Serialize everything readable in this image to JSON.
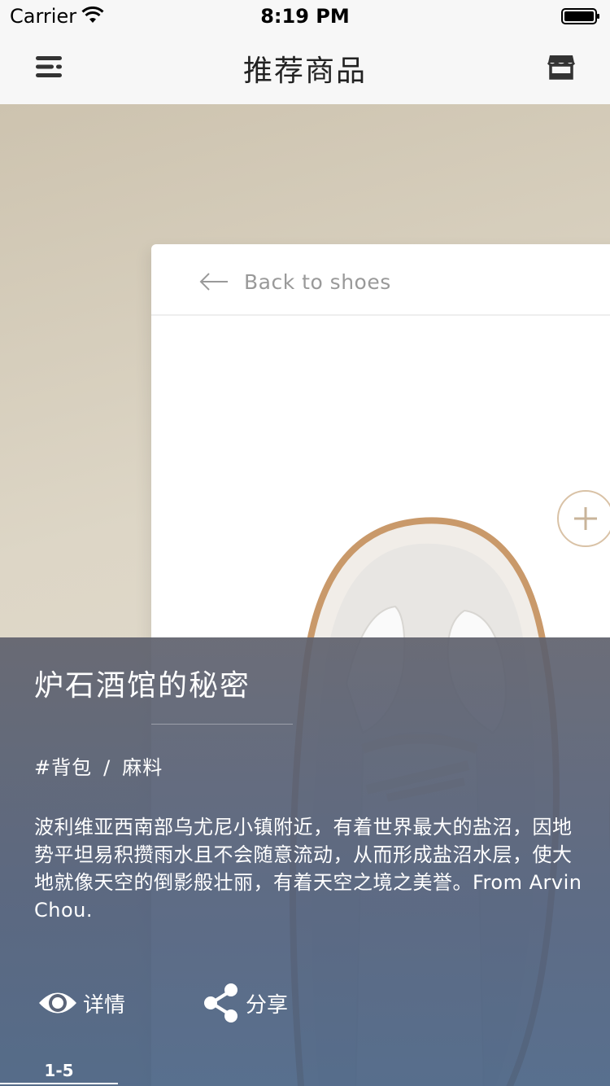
{
  "status_bar": {
    "carrier": "Carrier",
    "time": "8:19 PM",
    "wifi_icon": "wifi-icon",
    "battery_icon": "battery-icon"
  },
  "nav_bar": {
    "title": "推荐商品",
    "left_icon": "menu-icon",
    "right_icon": "store-icon"
  },
  "detail_card": {
    "back_label": "Back to shoes",
    "back_icon": "arrow-left-icon",
    "add_icon": "plus-icon"
  },
  "info_panel": {
    "title": "炉石酒馆的秘密",
    "tag_primary": "#背包",
    "tag_separator": "/",
    "tag_secondary": "麻料",
    "description": "波利维亚西南部乌尤尼小镇附近，有着世界最大的盐沼，因地势平坦易积攒雨水且不会随意流动，从而形成盐沼水层，使大地就像天空的倒影般壮丽，有着天空之境之美誉。From Arvin Chou.",
    "actions": {
      "details_label": "详情",
      "share_label": "分享"
    },
    "pager": "1-5"
  },
  "colors": {
    "panel_background": "#5a6478",
    "card_accent": "#d9c2a6",
    "backdrop": "#cdc3af"
  }
}
